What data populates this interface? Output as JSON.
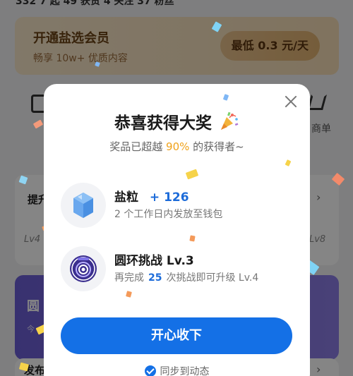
{
  "background": {
    "stats_text": "332 7 起    49 获赞    4 关注    37 粉丝",
    "vip": {
      "title": "开通盐选会员",
      "subtitle": "畅享 10w+ 优质内容",
      "price_button": "最低 0.3 元/天"
    },
    "shop_label": "商单",
    "panel_title": "提升",
    "level_left": "Lv4",
    "level_right": "Lv8",
    "purple_title": "圆",
    "purple_sub": "今",
    "bottom_title": "发布",
    "arrow": "›"
  },
  "modal": {
    "title": "恭喜获得大奖",
    "subtitle_prefix": "奖品已超越",
    "subtitle_percent": "90%",
    "subtitle_suffix": "的获得者~",
    "prizes": [
      {
        "name": "盐粒",
        "amount": "+ 126",
        "desc": "2 个工作日内发放至钱包",
        "icon": "salt-crystal-icon"
      },
      {
        "name": "圆环挑战 Lv.3",
        "desc_prefix": "再完成",
        "desc_num": "25",
        "desc_suffix": "次挑战即可升级 Lv.4",
        "icon": "ring-challenge-badge-icon"
      }
    ],
    "confirm_button": "开心收下",
    "sync_label": "同步到动态",
    "colors": {
      "accent": "#1470e6",
      "highlight": "#f0a21a"
    }
  }
}
